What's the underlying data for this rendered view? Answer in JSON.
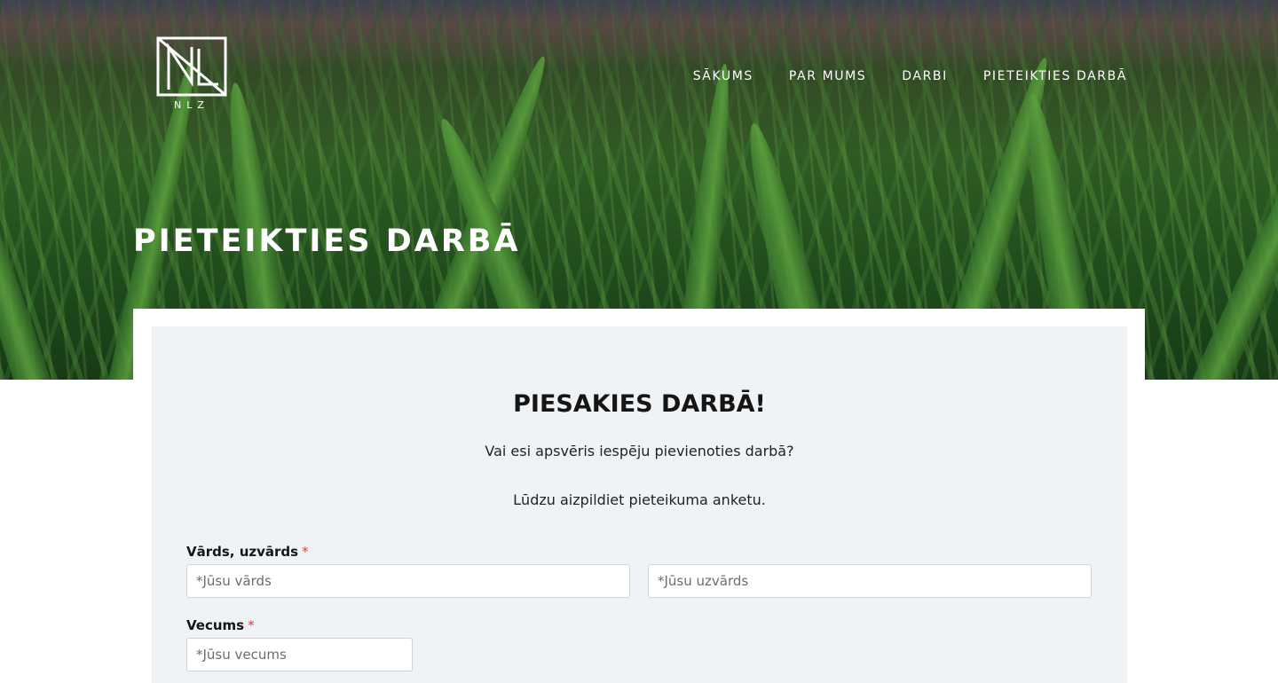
{
  "header": {
    "logo_text": "NLZ",
    "nav": [
      {
        "label": "SĀKUMS"
      },
      {
        "label": "PAR MUMS"
      },
      {
        "label": "DARBI"
      },
      {
        "label": "PIETEIKTIES DARBĀ"
      }
    ],
    "hero_title": "PIETEIKTIES DARBĀ"
  },
  "form": {
    "title": "PIESAKIES DARBĀ!",
    "intro_1": "Vai esi apsvēris iespēju pievienoties darbā?",
    "intro_2": "Lūdzu aizpildiet pieteikuma anketu.",
    "name_label": "Vārds, uzvārds",
    "required_mark": "*",
    "first_name_placeholder": "*Jūsu vārds",
    "last_name_placeholder": "*Jūsu uzvārds",
    "age_label": "Vecums",
    "age_placeholder": "*Jūsu vecums"
  },
  "colors": {
    "required": "#e03b3b",
    "card_bg": "#f0f3f6"
  }
}
